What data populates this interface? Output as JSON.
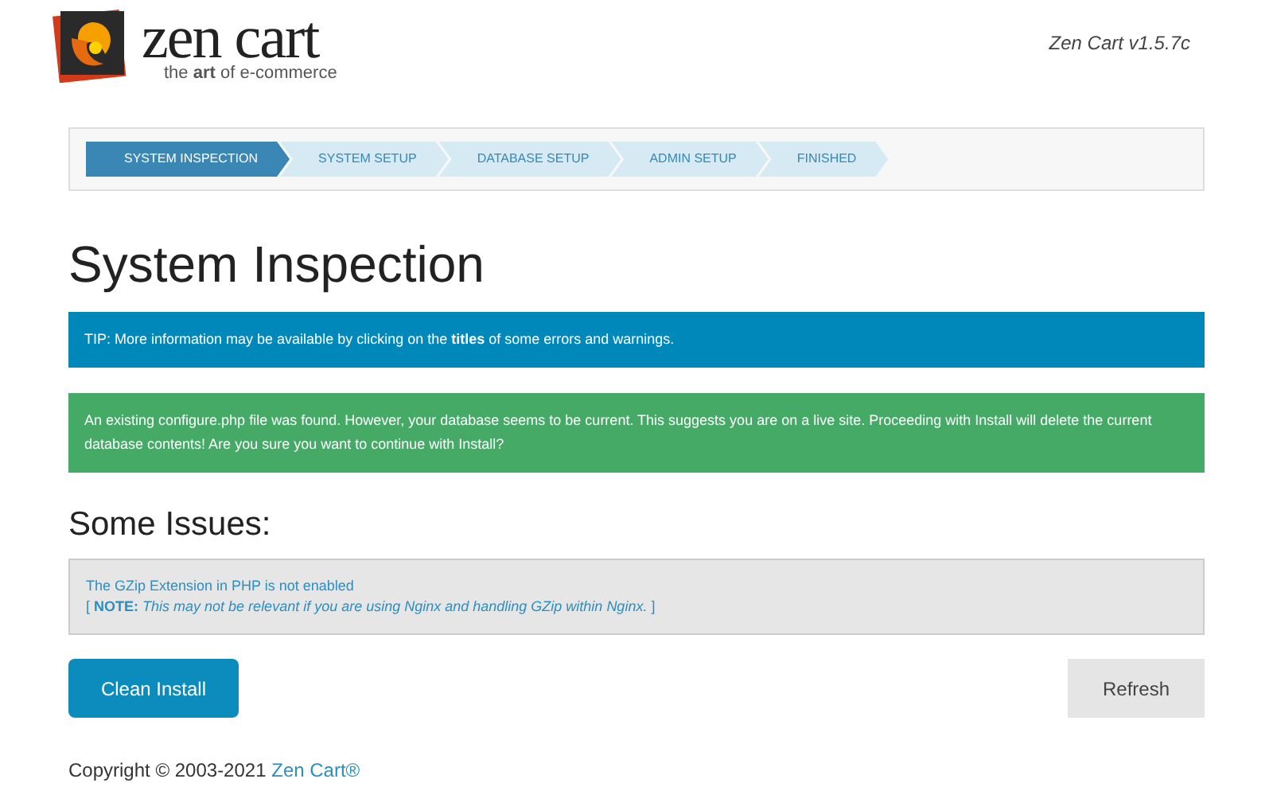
{
  "logo": {
    "name": "zen cart",
    "tagline": "the **art** of e-commerce"
  },
  "version": "Zen Cart v1.5.7c",
  "steps": [
    {
      "label": "SYSTEM INSPECTION",
      "selected": true
    },
    {
      "label": "SYSTEM SETUP",
      "selected": false
    },
    {
      "label": "DATABASE SETUP",
      "selected": false
    },
    {
      "label": "ADMIN SETUP",
      "selected": false
    },
    {
      "label": "FINISHED",
      "selected": false
    }
  ],
  "title": "System Inspection",
  "alerts": [
    {
      "kind": "info",
      "text": "TIP: More information may be available by clicking on the **titles** of some errors and warnings."
    },
    {
      "kind": "success",
      "text": "An existing configure.php file was found. However, your database seems to be current. This suggests you are on a live site. Proceeding with Install will delete the current database contents! Are you sure you want to continue with Install?"
    }
  ],
  "issues_heading": "Some Issues:",
  "issues": [
    {
      "title": "The GZip Extension in PHP is not enabled",
      "note": "[ **NOTE:** *This may not be relevant if you are using Nginx and handling GZip within Nginx.* ]"
    }
  ],
  "buttons": [
    {
      "kind": "primary",
      "label": "Clean Install"
    },
    {
      "kind": "secondary",
      "label": "Refresh"
    }
  ],
  "footer": {
    "copyright": "Copyright © 2003-2021",
    "link": "Zen Cart®"
  }
}
